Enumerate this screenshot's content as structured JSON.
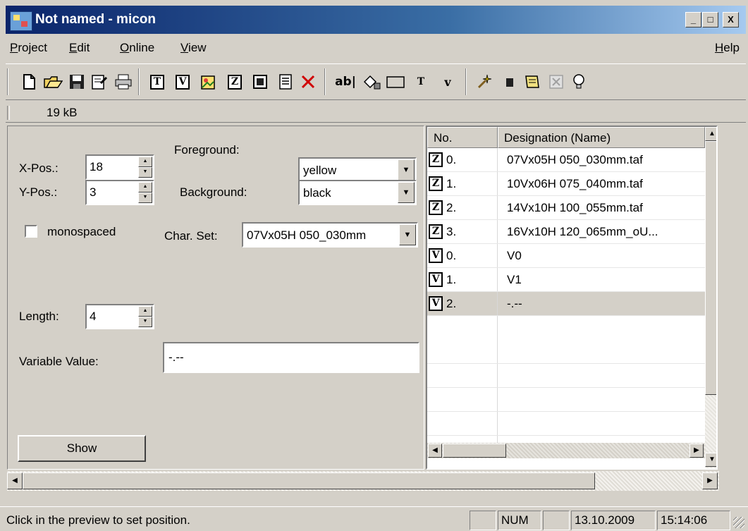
{
  "window": {
    "title": "Not named - micon"
  },
  "caption_buttons": {
    "minimize": "_",
    "maximize": "□",
    "close": "X"
  },
  "menu": {
    "items": [
      {
        "label": "Project",
        "accel": "P",
        "rest": "roject"
      },
      {
        "label": "Edit",
        "accel": "E",
        "rest": "dit"
      },
      {
        "label": "Online",
        "accel": "O",
        "rest": "nline"
      },
      {
        "label": "View",
        "accel": "V",
        "rest": "iew"
      }
    ],
    "help": {
      "accel": "H",
      "rest": "elp"
    }
  },
  "toolbar": {
    "text_label": "ab|",
    "letters": {
      "t": "T",
      "v": "V",
      "z": "Z",
      "t_small": "T",
      "v_small": "v"
    }
  },
  "sizebar": {
    "size_text": "19 kB"
  },
  "form": {
    "xpos_label": "X-Pos.:",
    "xpos_value": "18",
    "ypos_label": "Y-Pos.:",
    "ypos_value": "3",
    "foreground_label": "Foreground:",
    "foreground_value": "yellow",
    "background_label": "Background:",
    "background_value": "black",
    "monospaced_label": "monospaced",
    "charset_label": "Char. Set:",
    "charset_value": "07Vx05H 050_030mm",
    "length_label": "Length:",
    "length_value": "4",
    "variable_label": "Variable Value:",
    "variable_value": "-.--",
    "show_button": "Show"
  },
  "list": {
    "col_no": "No.",
    "col_name": "Designation (Name)",
    "rows": [
      {
        "type": "Z",
        "no": "0.",
        "name": "07Vx05H 050_030mm.taf"
      },
      {
        "type": "Z",
        "no": "1.",
        "name": "10Vx06H 075_040mm.taf"
      },
      {
        "type": "Z",
        "no": "2.",
        "name": "14Vx10H 100_055mm.taf"
      },
      {
        "type": "Z",
        "no": "3.",
        "name": "16Vx10H 120_065mm_oU..."
      },
      {
        "type": "V",
        "no": "0.",
        "name": "V0"
      },
      {
        "type": "V",
        "no": "1.",
        "name": "V1"
      },
      {
        "type": "V",
        "no": "2.",
        "name": "-.--"
      }
    ],
    "selected_index": 6
  },
  "statusbar": {
    "message": "Click in the preview to set position.",
    "num": "NUM",
    "date": "13.10.2009",
    "time": "15:14:06"
  }
}
